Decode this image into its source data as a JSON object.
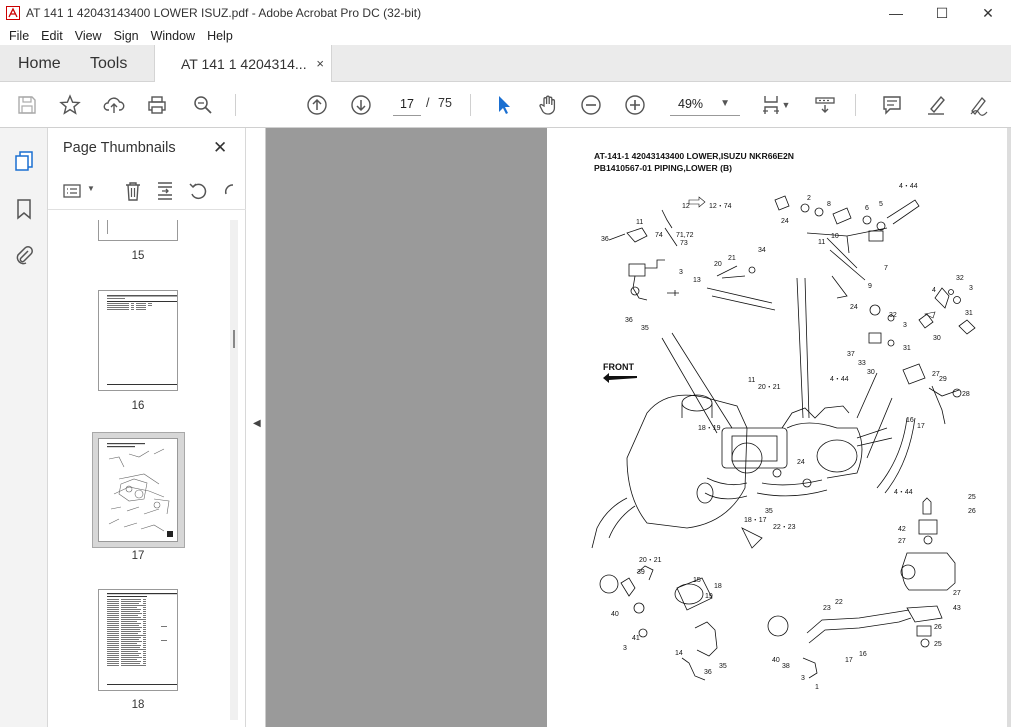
{
  "window": {
    "title": "AT 141 1 42043143400 LOWER ISUZ.pdf - Adobe Acrobat Pro DC (32-bit)",
    "minimize": "—",
    "maximize": "☐",
    "close": "✕"
  },
  "menu": [
    "File",
    "Edit",
    "View",
    "Sign",
    "Window",
    "Help"
  ],
  "tabs": {
    "home": "Home",
    "tools": "Tools",
    "document": "AT 141 1 4204314...",
    "close": "×"
  },
  "toolbar": {
    "page_current": "17",
    "page_sep": "/",
    "page_total": "75",
    "zoom": "49%",
    "icons": [
      "save-icon",
      "star-icon",
      "upload-icon",
      "print-icon",
      "search-zoom-icon",
      "prev-page-icon",
      "next-page-icon",
      "select-cursor-icon",
      "hand-icon",
      "zoom-out-icon",
      "zoom-in-icon",
      "page-fit-icon",
      "scroll-mode-icon",
      "comment-icon",
      "highlight-pen-icon",
      "sign-icon"
    ]
  },
  "thumbnails_panel": {
    "title": "Page Thumbnails",
    "close": "✕",
    "pages": [
      {
        "label": "15",
        "selected": false
      },
      {
        "label": "16",
        "selected": false
      },
      {
        "label": "17",
        "selected": true
      },
      {
        "label": "18",
        "selected": false
      }
    ]
  },
  "document_page": {
    "header_line1": "AT-141-1 42043143400 LOWER,ISUZU NKR66E2N",
    "header_line2": "PB1410567-01 PIPING,LOWER (B)",
    "front_label": "FRONT",
    "callouts": [
      "12",
      "12・74",
      "2",
      "8",
      "6",
      "5",
      "4・44",
      "24",
      "11",
      "74",
      "71,72",
      "73",
      "36",
      "10",
      "11",
      "3",
      "13",
      "20",
      "21",
      "34",
      "7",
      "9",
      "32",
      "3",
      "4",
      "36",
      "35",
      "24",
      "32",
      "3",
      "31",
      "30",
      "37",
      "33",
      "30",
      "31",
      "11",
      "20・21",
      "4・44",
      "27",
      "29",
      "28",
      "18・19",
      "24",
      "16",
      "17",
      "35",
      "18・17",
      "22・23",
      "4・44",
      "25",
      "26",
      "42",
      "27",
      "27",
      "43",
      "20・21",
      "39",
      "15",
      "18",
      "19",
      "40",
      "14",
      "3",
      "41",
      "36",
      "35",
      "23",
      "22",
      "40",
      "38",
      "17",
      "16",
      "3",
      "1",
      "26",
      "25"
    ]
  }
}
